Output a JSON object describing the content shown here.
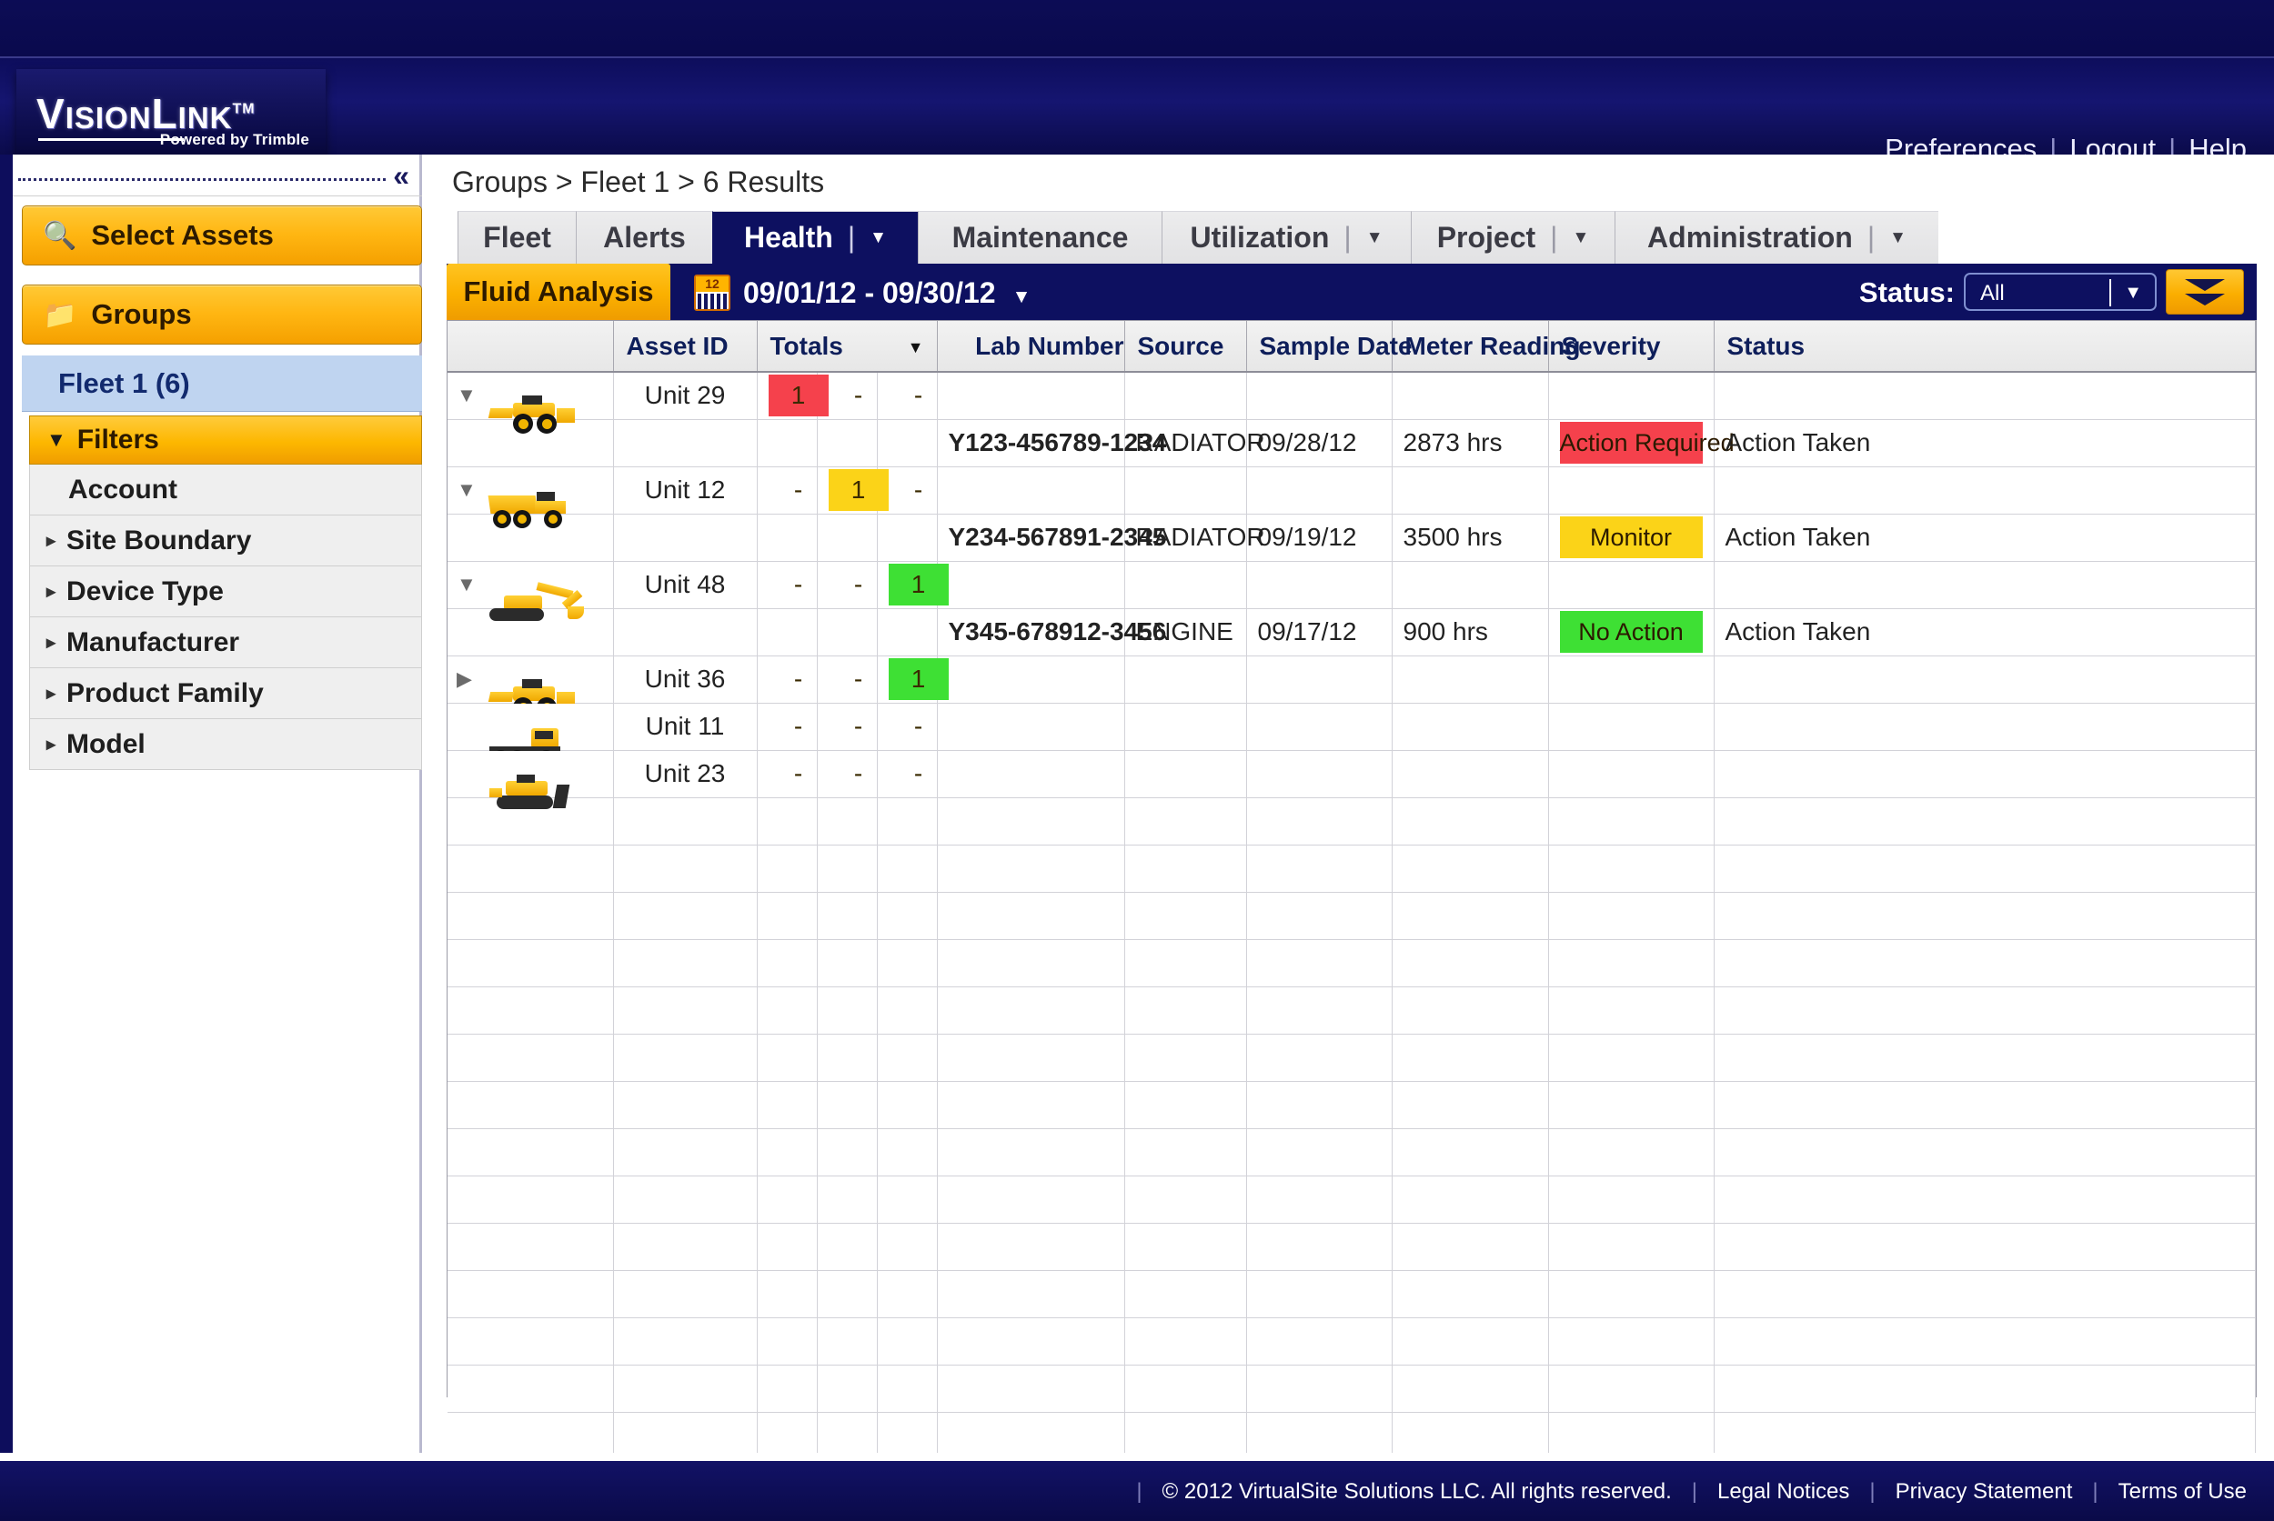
{
  "brand": {
    "name_part1": "V",
    "name_part2": "ISION",
    "name_part3": "L",
    "name_part4": "INK",
    "tm": "TM",
    "tagline": "Powered by Trimble"
  },
  "topnav": {
    "preferences": "Preferences",
    "logout": "Logout",
    "help": "Help",
    "separator": "|"
  },
  "sidebar": {
    "collapse_icon": "«",
    "select_assets": "Select Assets",
    "select_assets_icon": "🔍",
    "groups": "Groups",
    "groups_icon": "📁",
    "fleet": "Fleet 1 (6)",
    "filters_label": "Filters",
    "filters_caret": "▼",
    "filter_items": [
      {
        "label": "Account",
        "expandable": false
      },
      {
        "label": "Site Boundary",
        "expandable": true
      },
      {
        "label": "Device Type",
        "expandable": true
      },
      {
        "label": "Manufacturer",
        "expandable": true
      },
      {
        "label": "Product Family",
        "expandable": true
      },
      {
        "label": "Model",
        "expandable": true
      }
    ],
    "expand_caret": "▸"
  },
  "main": {
    "breadcrumb": "Groups > Fleet 1  > 6 Results",
    "tabs": [
      {
        "label": "Fleet",
        "active": false,
        "caret": false
      },
      {
        "label": "Alerts",
        "active": false,
        "caret": false
      },
      {
        "label": "Health",
        "active": true,
        "caret": true
      },
      {
        "label": "Maintenance",
        "active": false,
        "caret": false
      },
      {
        "label": "Utilization",
        "active": false,
        "caret": true
      },
      {
        "label": "Project",
        "active": false,
        "caret": true
      },
      {
        "label": "Administration",
        "active": false,
        "caret": true
      }
    ],
    "caret_glyph": "▼",
    "vbar_glyph": "|"
  },
  "toolbar": {
    "fluid_analysis": "Fluid Analysis",
    "calendar_month": "12",
    "date_range": "09/01/12 - 09/30/12",
    "date_caret": "▼",
    "status_label": "Status:",
    "status_value": "All",
    "status_caret": "▼",
    "status_options": [
      "All"
    ]
  },
  "table": {
    "headers": [
      "",
      "Asset ID",
      "Totals",
      "Lab Number",
      "Source",
      "Sample Date",
      "Meter Reading",
      "Severity",
      "Status"
    ],
    "sort_caret": "▼",
    "dash": "-",
    "expanded_glyph": "▼",
    "collapsed_glyph": "▶",
    "rows": [
      {
        "type": "asset",
        "asset_id": "Unit 29",
        "machine": "wheel-loader",
        "expander": "expanded",
        "totals": [
          {
            "value": "1",
            "color": "#f5414c"
          },
          {
            "value": "-",
            "color": null
          },
          {
            "value": "-",
            "color": null
          }
        ]
      },
      {
        "type": "detail",
        "lab_number": "Y123-456789-1234",
        "source": "RADIATOR",
        "sample_date": "09/28/12",
        "meter_reading": "2873 hrs",
        "severity": "Action Required",
        "severity_color": "#f5414c",
        "status": "Action Taken"
      },
      {
        "type": "asset",
        "asset_id": "Unit 12",
        "machine": "dump-truck",
        "expander": "expanded",
        "totals": [
          {
            "value": "-",
            "color": null
          },
          {
            "value": "1",
            "color": "#fbd318"
          },
          {
            "value": "-",
            "color": null
          }
        ]
      },
      {
        "type": "detail",
        "lab_number": "Y234-567891-2345",
        "source": "RADIATOR",
        "sample_date": "09/19/12",
        "meter_reading": "3500 hrs",
        "severity": "Monitor",
        "severity_color": "#fbd318",
        "status": "Action Taken"
      },
      {
        "type": "asset",
        "asset_id": "Unit 48",
        "machine": "excavator",
        "expander": "expanded",
        "totals": [
          {
            "value": "-",
            "color": null
          },
          {
            "value": "-",
            "color": null
          },
          {
            "value": "1",
            "color": "#3ee034"
          }
        ]
      },
      {
        "type": "detail",
        "lab_number": "Y345-678912-3456",
        "source": "ENGINE",
        "sample_date": "09/17/12",
        "meter_reading": "900 hrs",
        "severity": "No Action",
        "severity_color": "#3ee034",
        "status": "Action Taken"
      },
      {
        "type": "asset",
        "asset_id": "Unit 36",
        "machine": "wheel-loader",
        "expander": "collapsed",
        "totals": [
          {
            "value": "-",
            "color": null
          },
          {
            "value": "-",
            "color": null
          },
          {
            "value": "1",
            "color": "#3ee034"
          }
        ]
      },
      {
        "type": "asset",
        "asset_id": "Unit 11",
        "machine": "truck",
        "expander": "none",
        "totals": [
          {
            "value": "-",
            "color": null
          },
          {
            "value": "-",
            "color": null
          },
          {
            "value": "-",
            "color": null
          }
        ]
      },
      {
        "type": "asset",
        "asset_id": "Unit 23",
        "machine": "dozer",
        "expander": "none",
        "totals": [
          {
            "value": "-",
            "color": null
          },
          {
            "value": "-",
            "color": null
          },
          {
            "value": "-",
            "color": null
          }
        ]
      }
    ],
    "empty_rows": 14
  },
  "footer": {
    "copyright": "© 2012 VirtualSite Solutions LLC. All rights reserved.",
    "links": [
      "Legal Notices",
      "Privacy Statement",
      "Terms of Use"
    ],
    "pipe": "|"
  },
  "colors": {
    "navy": "#0d1060",
    "orange": "#fbb000",
    "red": "#f5414c",
    "yellow": "#fbd318",
    "green": "#3ee034",
    "link_blue": "#11216e"
  }
}
